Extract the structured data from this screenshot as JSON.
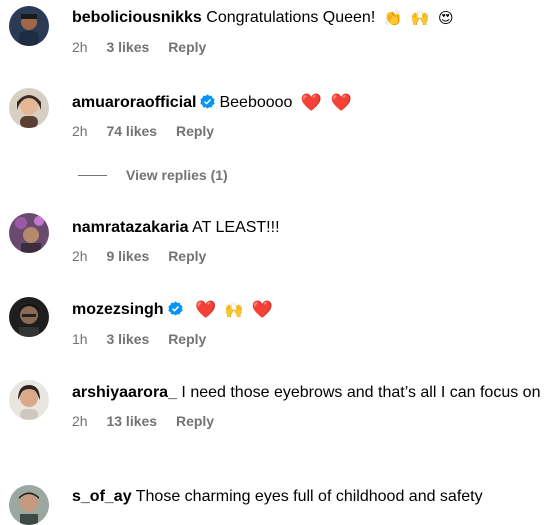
{
  "comments": [
    {
      "username": "beboliciousnikks",
      "text": "Congratulations Queen!",
      "emojis": [
        "👏",
        "🙌",
        "😍"
      ],
      "verified": false,
      "time": "2h",
      "likes": "3 likes",
      "reply": "Reply"
    },
    {
      "username": "amuaroraofficial",
      "text": "Beeboooo",
      "emojis": [
        "❤️",
        "❤️"
      ],
      "verified": true,
      "time": "2h",
      "likes": "74 likes",
      "reply": "Reply",
      "view_replies": "View replies (1)"
    },
    {
      "username": "namratazakaria",
      "text": "AT LEAST!!!",
      "emojis": [],
      "verified": false,
      "time": "2h",
      "likes": "9 likes",
      "reply": "Reply"
    },
    {
      "username": "mozezsingh",
      "text": "",
      "emojis": [
        "❤️",
        "🙌",
        "❤️"
      ],
      "verified": true,
      "time": "1h",
      "likes": "3 likes",
      "reply": "Reply"
    },
    {
      "username": "arshiyaarora_",
      "text": "I need those eyebrows and that’s all I can focus on",
      "emojis": [],
      "verified": false,
      "time": "2h",
      "likes": "13 likes",
      "reply": "Reply"
    },
    {
      "username": "s_of_ay",
      "text": "Those charming eyes full of childhood and safety",
      "emojis": [],
      "verified": false
    }
  ],
  "colors": {
    "verified_badge": "#0095f6",
    "meta_text": "#737373",
    "heart": "#e0245e"
  },
  "icons": {
    "verified": "verified-badge-icon"
  }
}
